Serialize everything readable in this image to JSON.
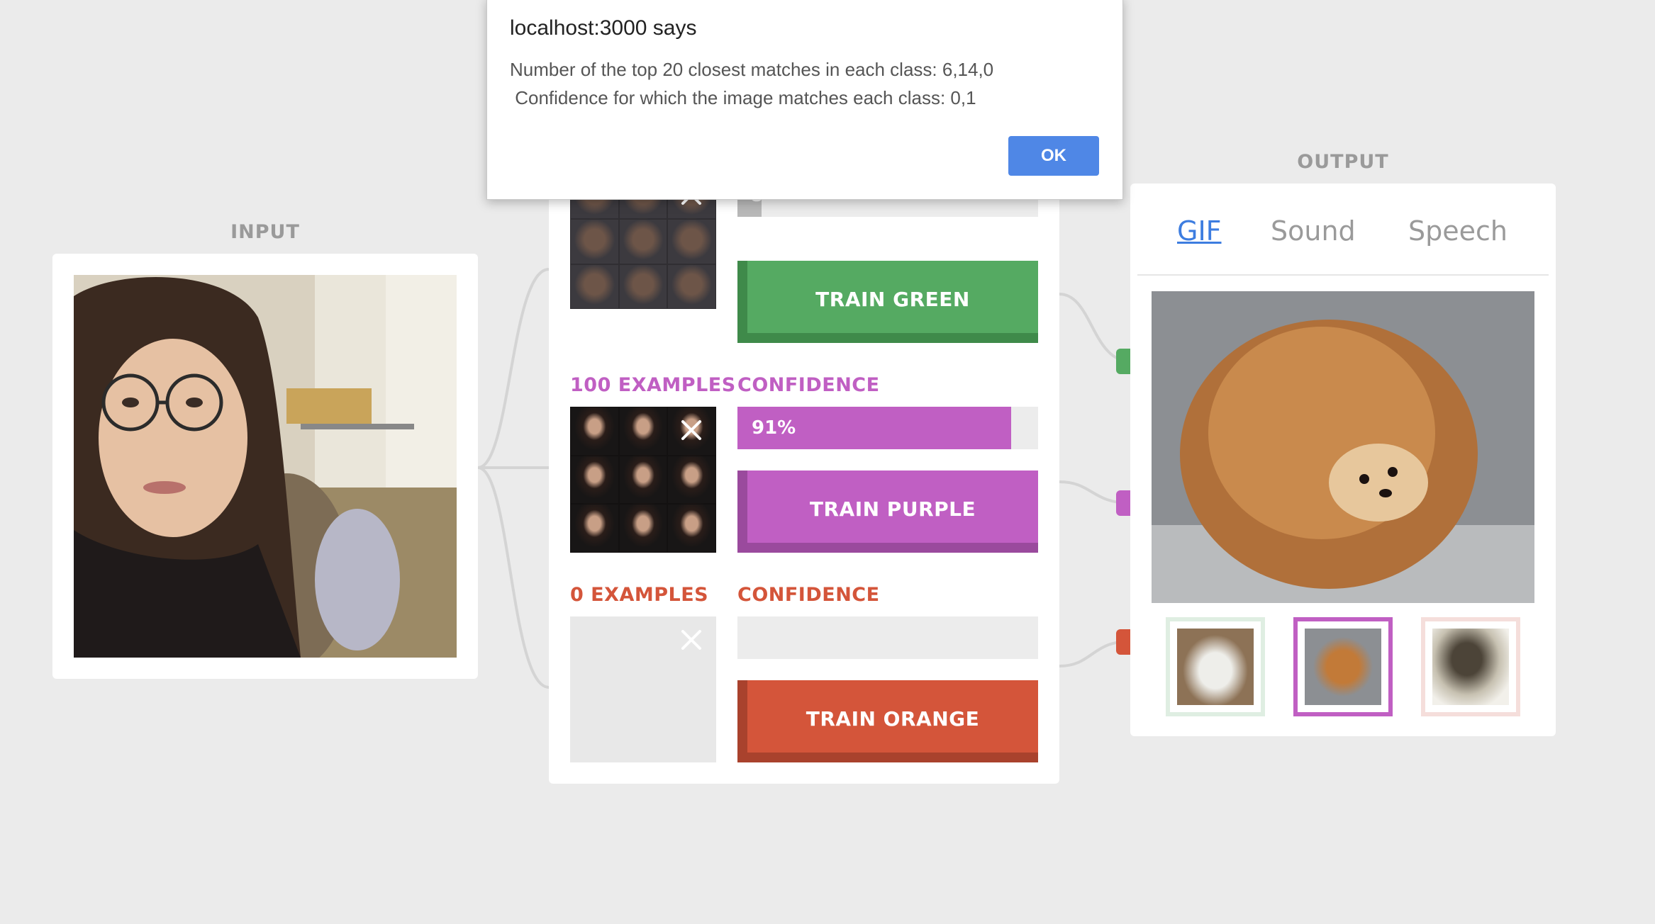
{
  "input": {
    "title": "INPUT"
  },
  "output": {
    "title": "OUTPUT",
    "tabs": [
      {
        "label": "GIF",
        "active": true
      },
      {
        "label": "Sound",
        "active": false
      },
      {
        "label": "Speech",
        "active": false
      }
    ]
  },
  "classes": [
    {
      "color_name": "green",
      "color": "#55aa62",
      "dark": "#3f8a4a",
      "examples": "",
      "confidence_label": "",
      "confidence_value": "8",
      "confidence_fill": 0.08,
      "train_label": "TRAIN GREEN"
    },
    {
      "color_name": "purple",
      "color": "#c05fc3",
      "dark": "#9a4a9d",
      "examples": "100 EXAMPLES",
      "confidence_label": "CONFIDENCE",
      "confidence_value": "91%",
      "confidence_fill": 0.91,
      "train_label": "TRAIN PURPLE"
    },
    {
      "color_name": "orange",
      "color": "#d4553a",
      "dark": "#a9422d",
      "examples": "0 EXAMPLES",
      "confidence_label": "CONFIDENCE",
      "confidence_value": "",
      "confidence_fill": 0,
      "train_label": "TRAIN ORANGE"
    }
  ],
  "dialog": {
    "title": "localhost:3000 says",
    "line1": "Number of the top 20 closest matches in each class: 6,14,0",
    "line2": " Confidence for which the image matches each class: 0,1",
    "ok_label": "OK"
  }
}
